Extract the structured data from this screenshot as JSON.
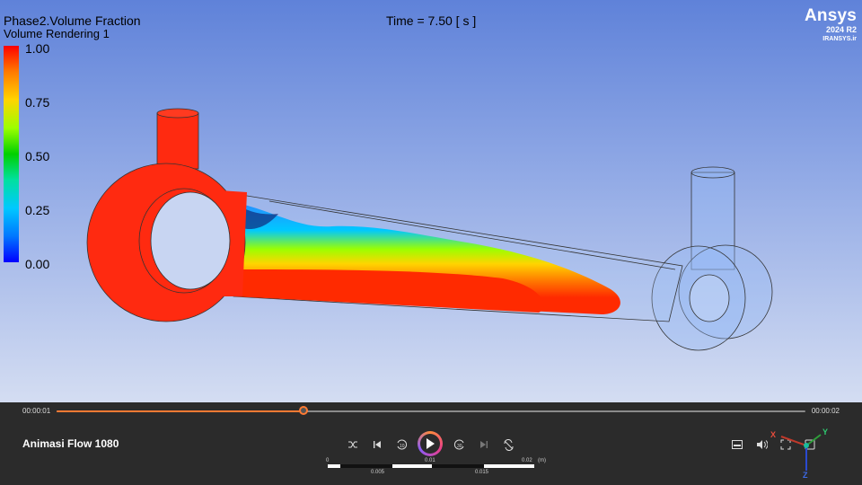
{
  "legend": {
    "title": "Phase2.Volume Fraction",
    "subtitle": "Volume Rendering 1",
    "ticks": [
      "1.00",
      "0.75",
      "0.50",
      "0.25",
      "0.00"
    ]
  },
  "time_label": "Time = 7.50 [ s ]",
  "brand": {
    "name": "Ansys",
    "version": "2024 R2",
    "site": "IRANSYS.ir"
  },
  "player": {
    "current_time": "00:00:01",
    "total_time": "00:00:02",
    "progress": 0.33,
    "title": "Animasi Flow 1080"
  },
  "scale": {
    "top_labels": [
      "0",
      "0.01",
      "0.02",
      "(m)"
    ],
    "bottom_labels": [
      "0.005",
      "0.015"
    ]
  },
  "axes": {
    "x": "X",
    "y": "Y",
    "z": "Z"
  },
  "colors": {
    "accent": "#ff7a33",
    "player_bg": "#2b2b2b"
  }
}
